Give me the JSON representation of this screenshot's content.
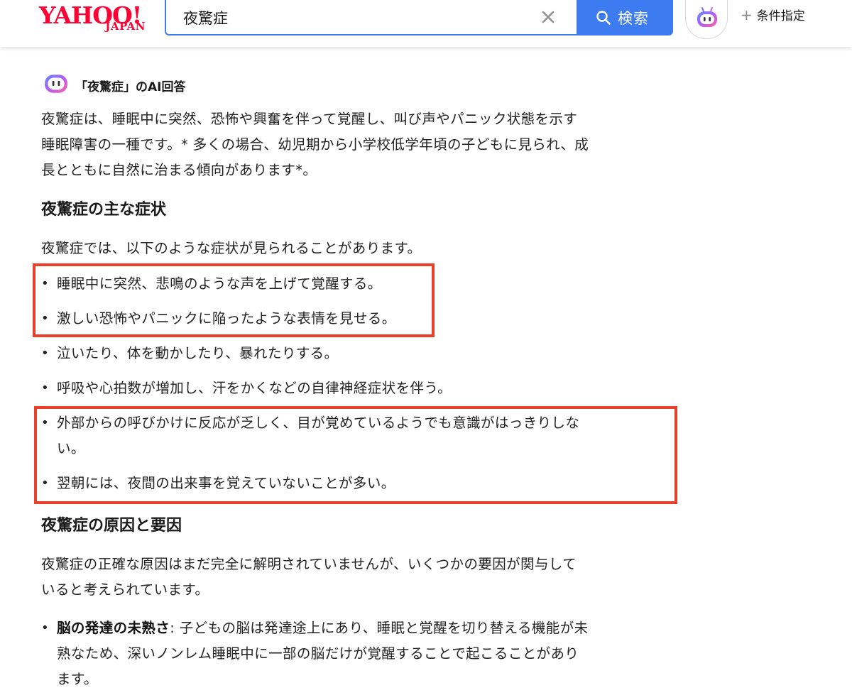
{
  "header": {
    "logo_main": "YAHOO!",
    "logo_sub": "JAPAN",
    "search_value": "夜驚症",
    "search_button_label": "検索",
    "conditions_label": "条件指定"
  },
  "ai_answer": {
    "title": "「夜驚症」のAI回答",
    "intro_line1": "夜驚症は、睡眠中に突然、恐怖や興奮を伴って覚醒し、叫び声やパニック状態を示す",
    "intro_line2": "睡眠障害の一種です。* 多くの場合、幼児期から小学校低学年頃の子どもに見られ、成",
    "intro_line3": "長とともに自然に治まる傾向があります*。",
    "symptoms_heading": "夜驚症の主な症状",
    "symptoms_lead": "夜驚症では、以下のような症状が見られることがあります。",
    "symptoms": [
      "睡眠中に突然、悲鳴のような声を上げて覚醒する。",
      "激しい恐怖やパニックに陥ったような表情を見せる。",
      "泣いたり、体を動かしたり、暴れたりする。",
      "呼吸や心拍数が増加し、汗をかくなどの自律神経症状を伴う。",
      "外部からの呼びかけに反応が乏しく、目が覚めているようでも意識がはっきりしな",
      "い。",
      "翌朝には、夜間の出来事を覚えていないことが多い。"
    ],
    "causes_heading": "夜驚症の原因と要因",
    "causes_lead_line1": "夜驚症の正確な原因はまだ完全に解明されていませんが、いくつかの要因が関与して",
    "causes_lead_line2": "いると考えられています。",
    "cause1_term": "脳の発達の未熟さ",
    "cause1_line1": ": 子どもの脳は発達途上にあり、睡眠と覚醒を切り替える機能が未",
    "cause1_line2": "熟なため、深いノンレム睡眠中に一部の脳だけが覚醒することで起こることがあり",
    "cause1_line3": "ます。"
  },
  "colors": {
    "brand": "#ff0033",
    "accent": "#3d7bf0",
    "highlight": "#e8402b"
  },
  "icons": [
    "clear-icon",
    "search-icon",
    "ai-assistant-icon",
    "plus-icon"
  ]
}
